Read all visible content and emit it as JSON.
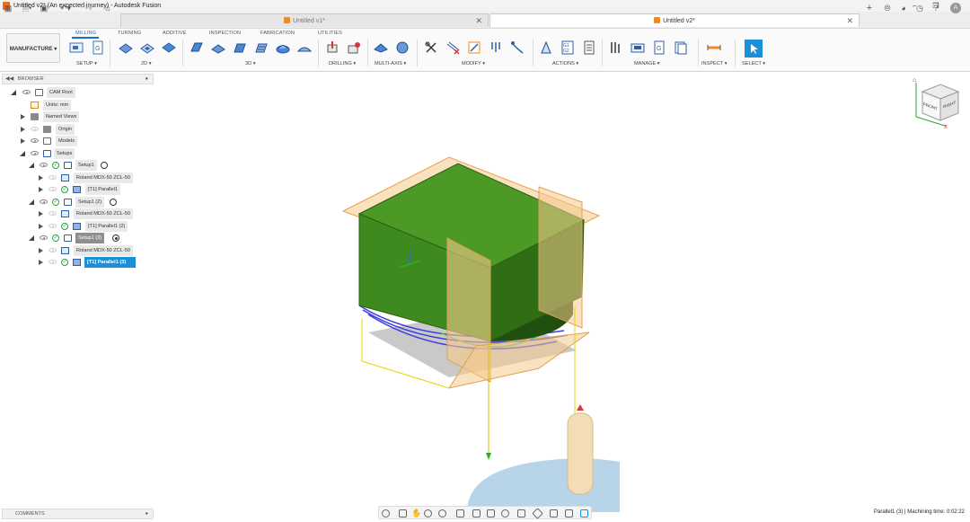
{
  "window": {
    "title": "Untitled v2* (An expected journey) - Autodesk Fusion"
  },
  "tabs": [
    {
      "label": "Untitled v1*",
      "active": false
    },
    {
      "label": "Untitled v2*",
      "active": true
    }
  ],
  "workspace": {
    "label": "MANUFACTURE"
  },
  "ribbon_tabs": [
    "MILLING",
    "TURNING",
    "ADDITIVE",
    "INSPECTION",
    "FABRICATION",
    "UTILITIES"
  ],
  "ribbon_groups": [
    "SETUP",
    "2D",
    "3D",
    "DRILLING",
    "MULTI-AXIS",
    "MODIFY",
    "ACTIONS",
    "MANAGE",
    "INSPECT",
    "SELECT"
  ],
  "browser": {
    "title": "BROWSER",
    "items": [
      {
        "label": "CAM Root"
      },
      {
        "label": "Units: mm"
      },
      {
        "label": "Named Views"
      },
      {
        "label": "Origin"
      },
      {
        "label": "Models"
      },
      {
        "label": "Setups"
      },
      {
        "label": "Setup1"
      },
      {
        "label": "Roland MDX-50 ZCL-50"
      },
      {
        "label": "[T1] Parallel1"
      },
      {
        "label": "Setup1 (2)"
      },
      {
        "label": "Roland MDX-50 ZCL-50"
      },
      {
        "label": "[T1] Parallel1 (2)"
      },
      {
        "label": "Setup1 (3)"
      },
      {
        "label": "Roland MDX-50 ZCL-50"
      },
      {
        "label": "[T1] Parallel1 (3)"
      }
    ]
  },
  "comments": {
    "title": "COMMENTS"
  },
  "viewcube": {
    "front": "FRONT",
    "right": "RIGHT"
  },
  "status": {
    "text": "Parallel1 (3) | Machining time: 0:02:22"
  },
  "colors": {
    "accent": "#1b8fd8",
    "stock": "#f6c98b",
    "model_green": "#3f8a1f"
  }
}
